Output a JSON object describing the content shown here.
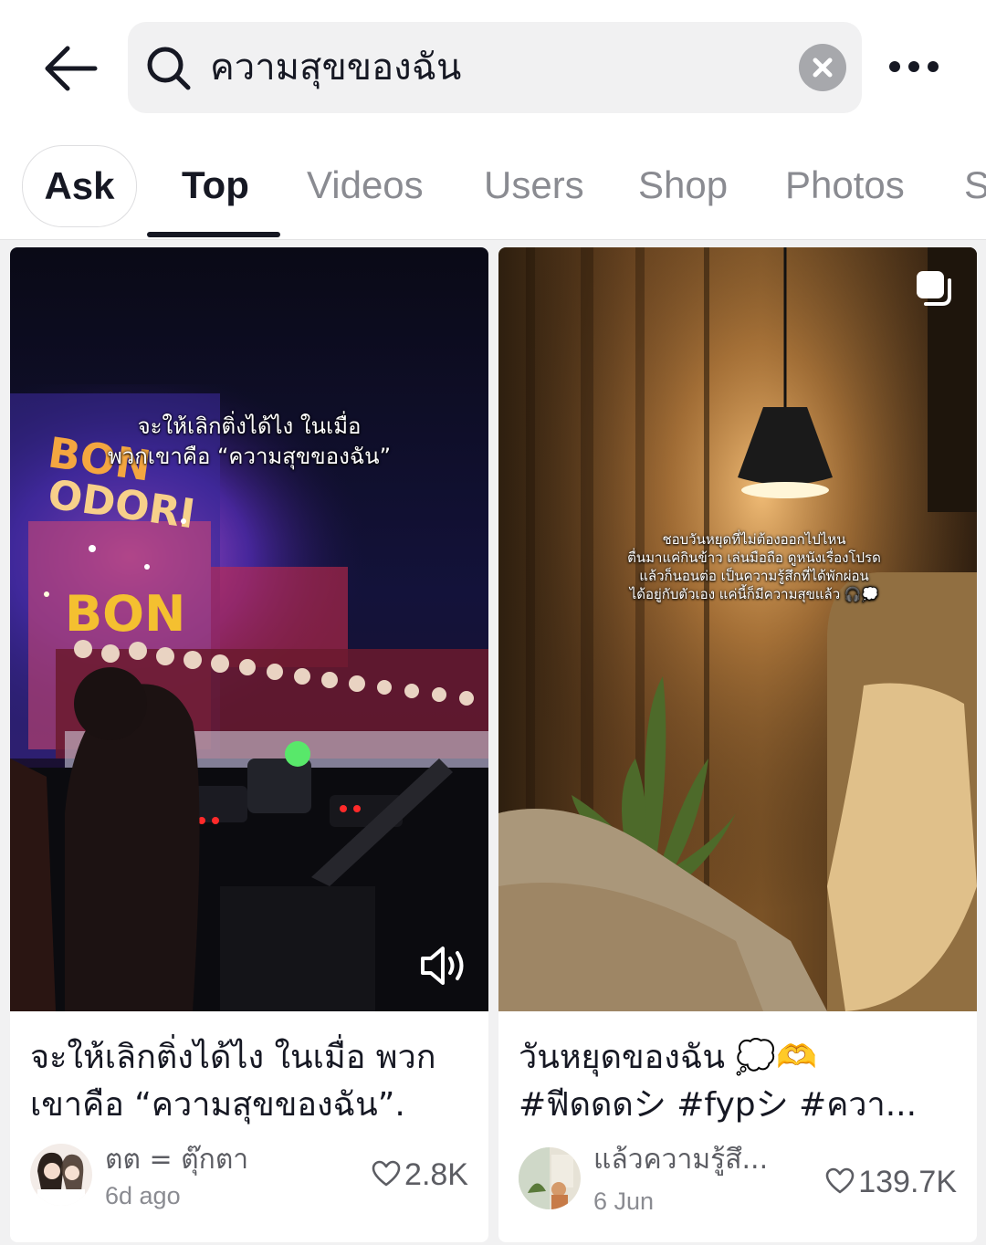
{
  "search": {
    "query": "ความสุขของฉัน"
  },
  "tabs": [
    {
      "label": "Ask"
    },
    {
      "label": "Top"
    },
    {
      "label": "Videos"
    },
    {
      "label": "Users"
    },
    {
      "label": "Shop"
    },
    {
      "label": "Photos"
    },
    {
      "label": "S"
    }
  ],
  "results": [
    {
      "overlay_lines": [
        "จะให้เลิกติ่งได้ไง ในเมื่อ",
        "พวกเขาคือ “ความสุขของฉัน”"
      ],
      "caption_lines": [
        "จะให้เลิกติ่งได้ไง ในเมื่อ พวก",
        "เขาคือ “ความสุขของฉัน”."
      ],
      "author": "ตต = ตุ๊กตา",
      "date": "6d ago",
      "likes": "2.8K",
      "media_type": "video",
      "sound_icon": "speaker-icon"
    },
    {
      "overlay_lines": [
        "ชอบวันหยุดที่ไม่ต้องออกไปไหน",
        "ตื่นมาแค่กินข้าว เล่นมือถือ ดูหนังเรื่องโปรด",
        "แล้วก็นอนต่อ เป็นความรู้สึกที่ได้พักผ่อน",
        "ได้อยู่กับตัวเอง แค่นี้ก็มีความสุขแล้ว 🎧💭"
      ],
      "caption_lines": [
        "วันหยุดของฉัน 💭🫶",
        "#ฟีดดดシ #fypシ #ควา..."
      ],
      "author": "แล้วความรู้สึ...",
      "date": "6 Jun",
      "likes": "139.7K",
      "media_type": "photo-carousel"
    }
  ]
}
